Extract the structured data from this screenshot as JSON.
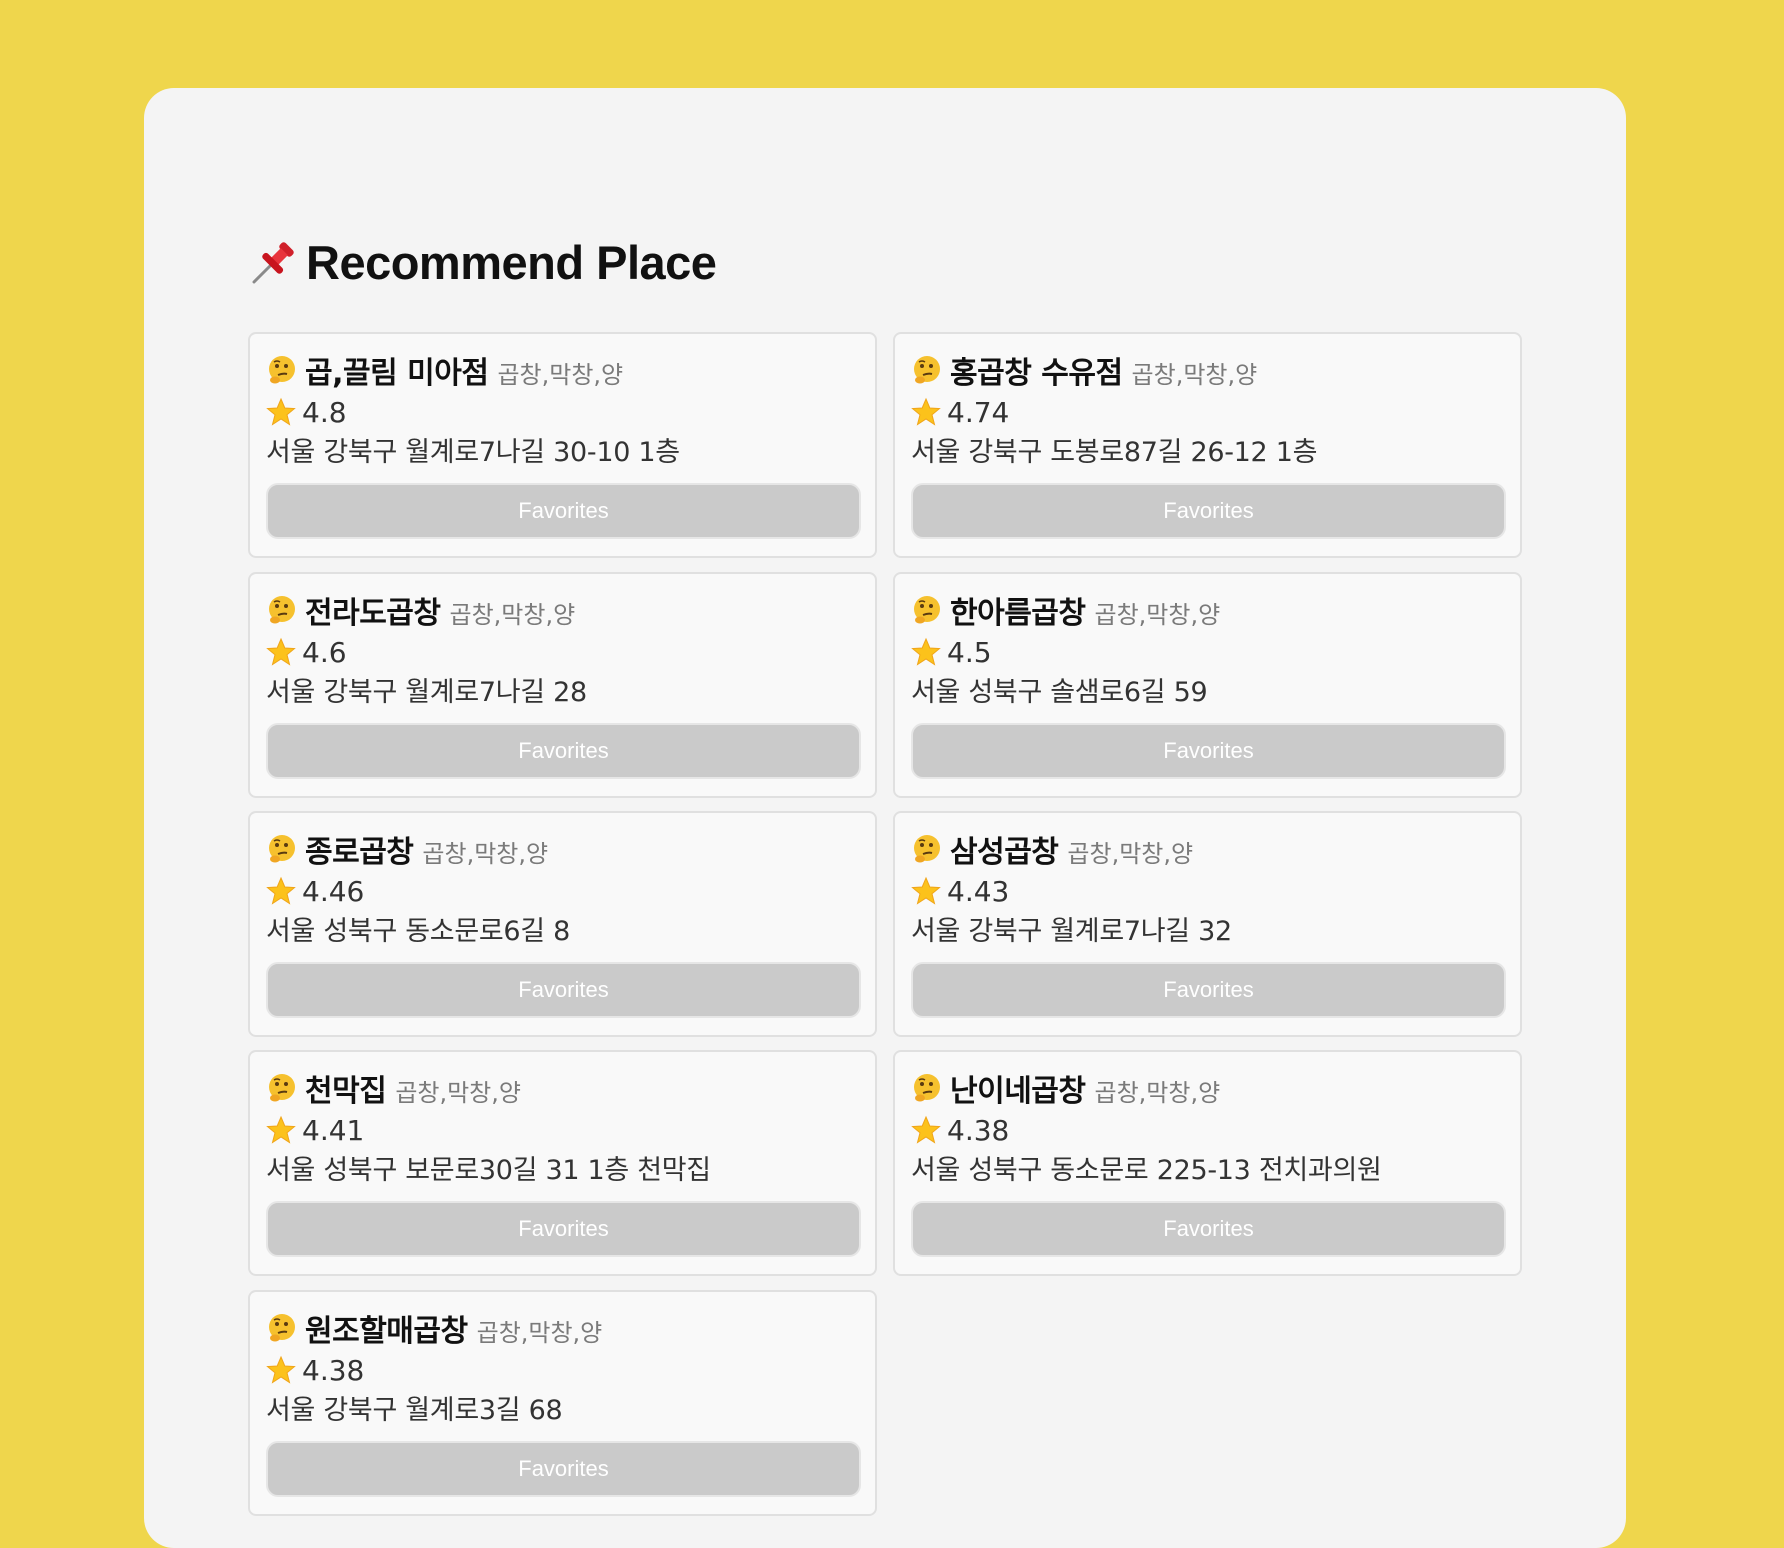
{
  "section": {
    "title": "Recommend Place",
    "icon": "pushpin-icon"
  },
  "places": [
    {
      "name": "곱,끌림 미아점",
      "category": "곱창,막창,양",
      "rating": "4.8",
      "address": "서울 강북구 월계로7나길 30-10 1층",
      "button": "Favorites"
    },
    {
      "name": "홍곱창 수유점",
      "category": "곱창,막창,양",
      "rating": "4.74",
      "address": "서울 강북구 도봉로87길 26-12 1층",
      "button": "Favorites"
    },
    {
      "name": "전라도곱창",
      "category": "곱창,막창,양",
      "rating": "4.6",
      "address": "서울 강북구 월계로7나길 28",
      "button": "Favorites"
    },
    {
      "name": "한아름곱창",
      "category": "곱창,막창,양",
      "rating": "4.5",
      "address": "서울 성북구 솔샘로6길 59",
      "button": "Favorites"
    },
    {
      "name": "종로곱창",
      "category": "곱창,막창,양",
      "rating": "4.46",
      "address": "서울 성북구 동소문로6길 8",
      "button": "Favorites"
    },
    {
      "name": "삼성곱창",
      "category": "곱창,막창,양",
      "rating": "4.43",
      "address": "서울 강북구 월계로7나길 32",
      "button": "Favorites"
    },
    {
      "name": "천막집",
      "category": "곱창,막창,양",
      "rating": "4.41",
      "address": "서울 성북구 보문로30길 31 1층 천막집",
      "button": "Favorites"
    },
    {
      "name": "난이네곱창",
      "category": "곱창,막창,양",
      "rating": "4.38",
      "address": "서울 성북구 동소문로 225-13 전치과의원",
      "button": "Favorites"
    },
    {
      "name": "원조할매곱창",
      "category": "곱창,막창,양",
      "rating": "4.38",
      "address": "서울 강북구 월계로3길 68",
      "button": "Favorites"
    }
  ],
  "colors": {
    "background": "#efd64c",
    "panel": "#f4f4f4",
    "card": "#f9f9f9",
    "button": "#cacaca"
  }
}
